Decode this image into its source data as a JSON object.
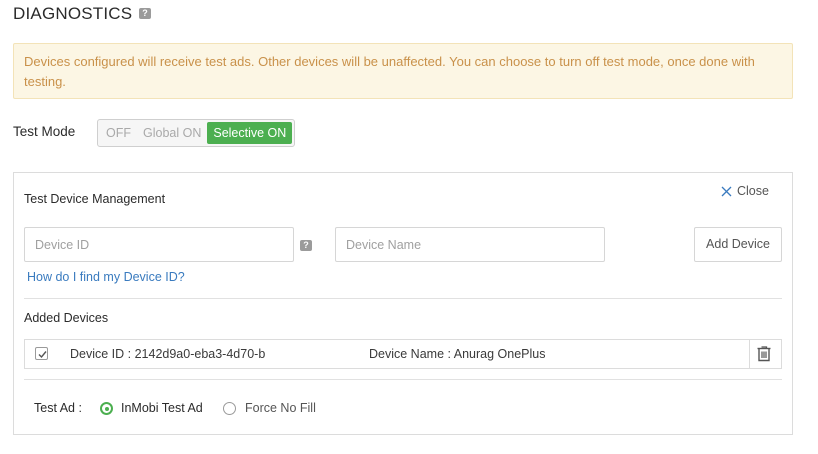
{
  "header": {
    "title": "DIAGNOSTICS",
    "help_glyph": "?"
  },
  "notice": {
    "text": "Devices configured will receive test ads. Other devices will be unaffected. You can choose to turn off test mode, once done with testing."
  },
  "test_mode": {
    "label": "Test Mode",
    "options": [
      "OFF",
      "Global ON",
      "Selective ON"
    ],
    "selected": "Selective ON",
    "active_color": "#4caf50"
  },
  "panel": {
    "title": "Test Device Management",
    "close_label": "Close",
    "device_id_placeholder": "Device ID",
    "device_name_placeholder": "Device Name",
    "add_button_label": "Add Device",
    "find_link": "How do I find my Device ID?",
    "added_devices_label": "Added Devices",
    "devices": [
      {
        "id_text": "Device ID : 2142d9a0-eba3-4d70-b",
        "name_text": "Device Name : Anurag OnePlus",
        "checked": true
      }
    ],
    "test_ad": {
      "label": "Test Ad :",
      "options": [
        "InMobi Test Ad",
        "Force No Fill"
      ],
      "selected": "InMobi Test Ad"
    }
  },
  "icons": {
    "help": "help-icon",
    "close": "close-icon",
    "trash": "trash-icon",
    "check": "check-icon"
  },
  "colors": {
    "notice_bg": "#fcf6e4",
    "notice_text": "#c9914a",
    "link": "#3a7bbf",
    "accent": "#4caf50"
  }
}
